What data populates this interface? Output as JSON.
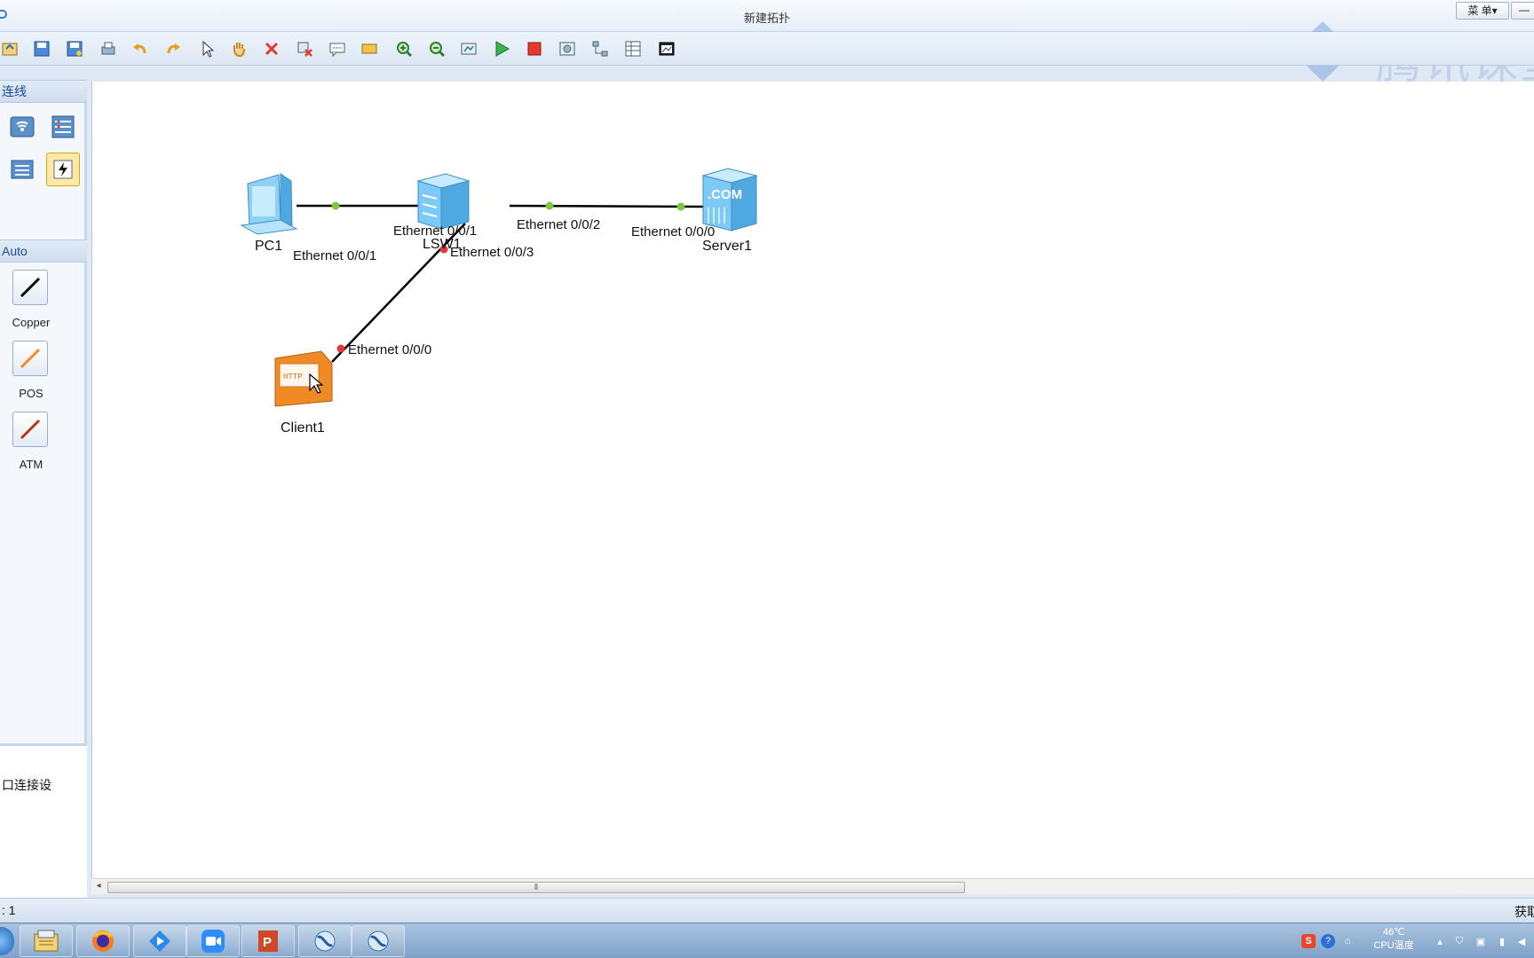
{
  "window": {
    "title": "新建拓扑",
    "menu_label": "菜 单▾",
    "min_label": "—"
  },
  "watermark": {
    "text": "腾讯课堂"
  },
  "toolbar": {
    "buttons": [
      "new-icon",
      "save-icon",
      "save-as-icon",
      "print-icon",
      "undo-icon",
      "redo-icon",
      "select-icon",
      "pan-hand-icon",
      "delete-icon",
      "delete-link-icon",
      "text-note-icon",
      "rectangle-icon",
      "zoom-in-icon",
      "zoom-out-icon",
      "fit-view-icon",
      "start-device-icon",
      "stop-device-icon",
      "capture-icon",
      "topology-icon",
      "grid-icon",
      "screenshot-icon"
    ]
  },
  "left_panel": {
    "section1_title": "连线",
    "section2_title": "Auto",
    "cables": [
      {
        "label": "Copper",
        "color": "#000000"
      },
      {
        "label": "POS",
        "color": "#f08a24"
      },
      {
        "label": "ATM",
        "color": "#b23a10"
      }
    ],
    "bottom_text": "口连接设"
  },
  "topology": {
    "nodes": {
      "pc1": "PC1",
      "lsw1": "LSW1",
      "server1": "Server1",
      "client1": "Client1"
    },
    "links": [
      {
        "from": "PC1",
        "from_port": "Ethernet 0/0/1",
        "to": "LSW1",
        "to_port": "Ethernet 0/0/1",
        "state": "up"
      },
      {
        "from": "LSW1",
        "from_port": "Ethernet 0/0/2",
        "to": "Server1",
        "to_port": "Ethernet 0/0/0",
        "state": "up"
      },
      {
        "from": "LSW1",
        "from_port": "Ethernet 0/0/3",
        "to": "Client1",
        "to_port": "Ethernet 0/0/0",
        "state": "down"
      }
    ],
    "status_colors": {
      "up": "#7cc83a",
      "down": "#e03a3a"
    }
  },
  "statusbar": {
    "left": ": 1",
    "right": "获取"
  },
  "taskbar": {
    "apps": [
      "start-orb-icon",
      "file-explorer-icon",
      "firefox-icon",
      "tencent-class-icon",
      "zoom-meeting-icon",
      "powerpoint-icon",
      "ensp-icon",
      "ensp-topology-icon"
    ],
    "cpu_temp": "46℃",
    "cpu_label": "CPU温度"
  }
}
